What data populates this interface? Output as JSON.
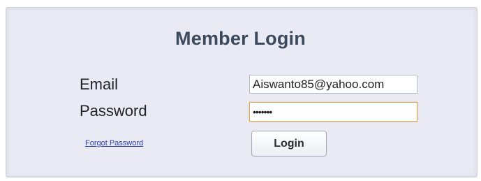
{
  "login_form": {
    "title": "Member Login",
    "email_label": "Email",
    "email_value": "Aiswanto85@yahoo.com",
    "password_label": "Password",
    "password_value": "•••••••",
    "forgot_link": "Forgot Password",
    "login_button": "Login"
  },
  "colors": {
    "panel_background": "#e9eaf3",
    "title_text": "#3b4a5c",
    "focus_border": "#d8a45a",
    "link": "#2a3ea8"
  }
}
